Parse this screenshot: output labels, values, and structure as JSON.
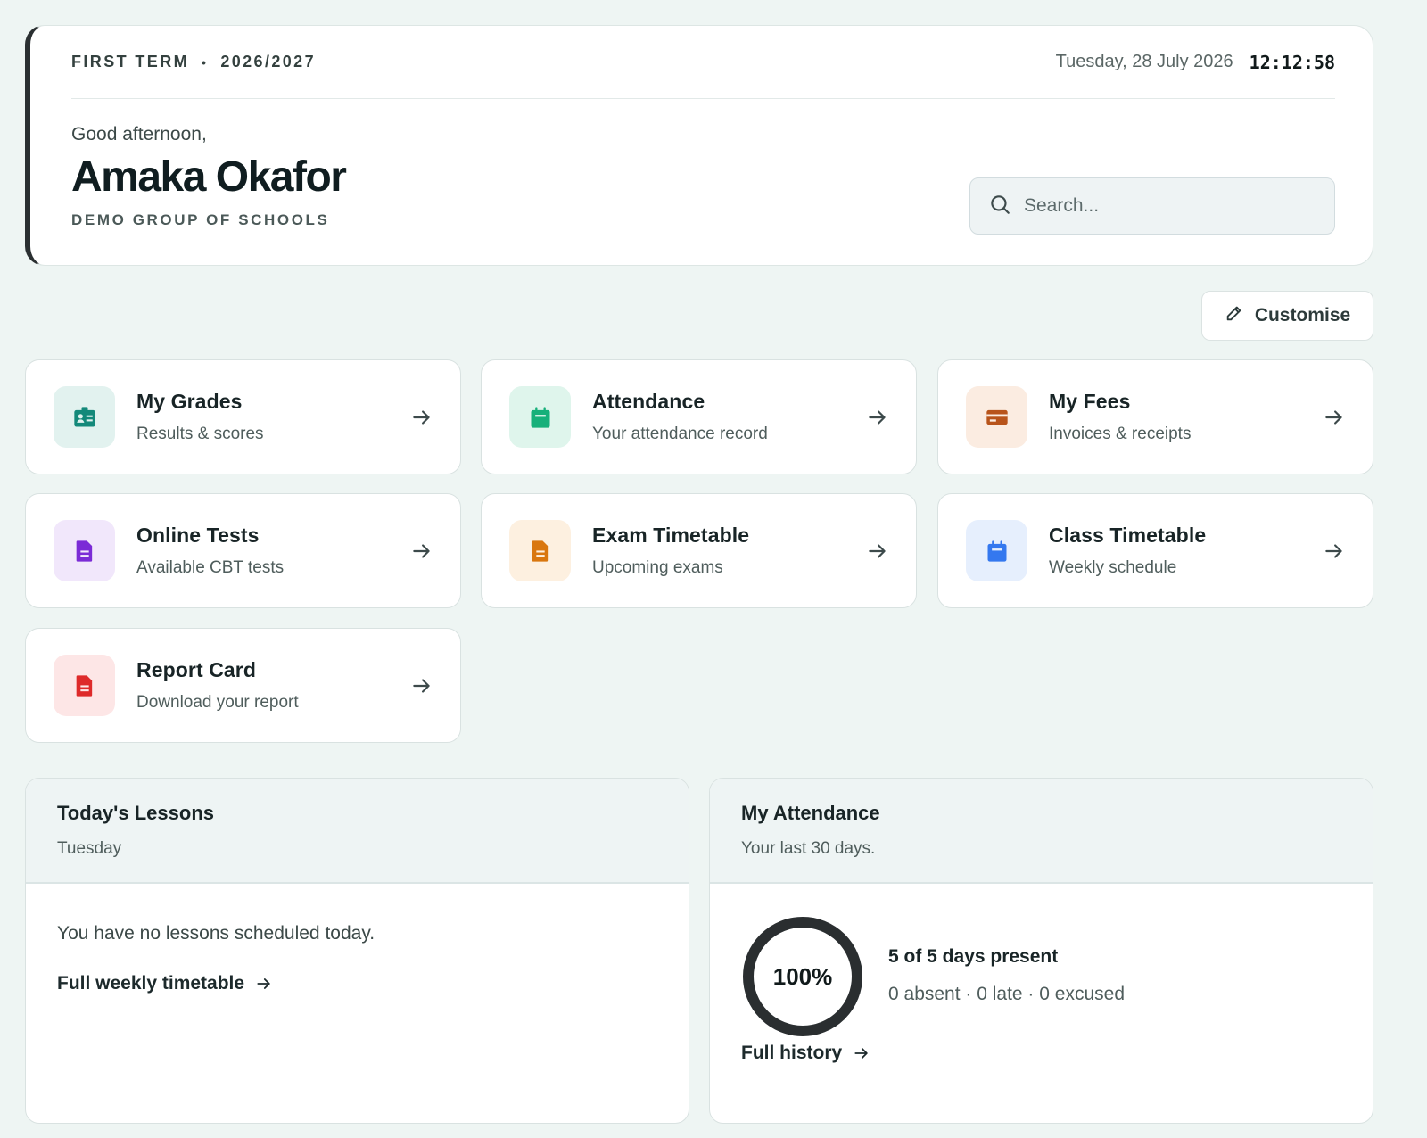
{
  "header": {
    "term": "FIRST TERM",
    "separator": "•",
    "session": "2026/2027",
    "date": "Tuesday, 28 July 2026",
    "time": "12:12:58",
    "greeting": "Good afternoon,",
    "user_name": "Amaka Okafor",
    "school": "DEMO GROUP OF SCHOOLS",
    "search_placeholder": "Search..."
  },
  "toolbar": {
    "customise_label": "Customise"
  },
  "tiles": [
    {
      "title": "My Grades",
      "subtitle": "Results & scores",
      "icon": "id-card-icon",
      "icon_color": "#14897a",
      "icon_bg": "#e2f2ef"
    },
    {
      "title": "Attendance",
      "subtitle": "Your attendance record",
      "icon": "calendar-icon",
      "icon_color": "#17b07a",
      "icon_bg": "#dff5ec"
    },
    {
      "title": "My Fees",
      "subtitle": "Invoices & receipts",
      "icon": "credit-card-icon",
      "icon_color": "#b8541b",
      "icon_bg": "#fbece1"
    },
    {
      "title": "Online Tests",
      "subtitle": "Available CBT tests",
      "icon": "document-icon",
      "icon_color": "#7b2bd6",
      "icon_bg": "#f1e7fb"
    },
    {
      "title": "Exam Timetable",
      "subtitle": "Upcoming exams",
      "icon": "document-icon",
      "icon_color": "#d9770f",
      "icon_bg": "#fdf0e0"
    },
    {
      "title": "Class Timetable",
      "subtitle": "Weekly schedule",
      "icon": "calendar-icon",
      "icon_color": "#3478ef",
      "icon_bg": "#e6effd"
    },
    {
      "title": "Report Card",
      "subtitle": "Download your report",
      "icon": "document-icon",
      "icon_color": "#de2a2a",
      "icon_bg": "#fde6e6"
    }
  ],
  "lessons": {
    "title": "Today's Lessons",
    "subtitle": "Tuesday",
    "empty_message": "You have no lessons scheduled today.",
    "link_label": "Full weekly timetable"
  },
  "attendance": {
    "title": "My Attendance",
    "subtitle": "Your last 30 days.",
    "percent_label": "100%",
    "present_fraction": 1.0,
    "summary": "5 of 5 days present",
    "detail": "0 absent · 0 late · 0 excused",
    "link_label": "Full history"
  }
}
